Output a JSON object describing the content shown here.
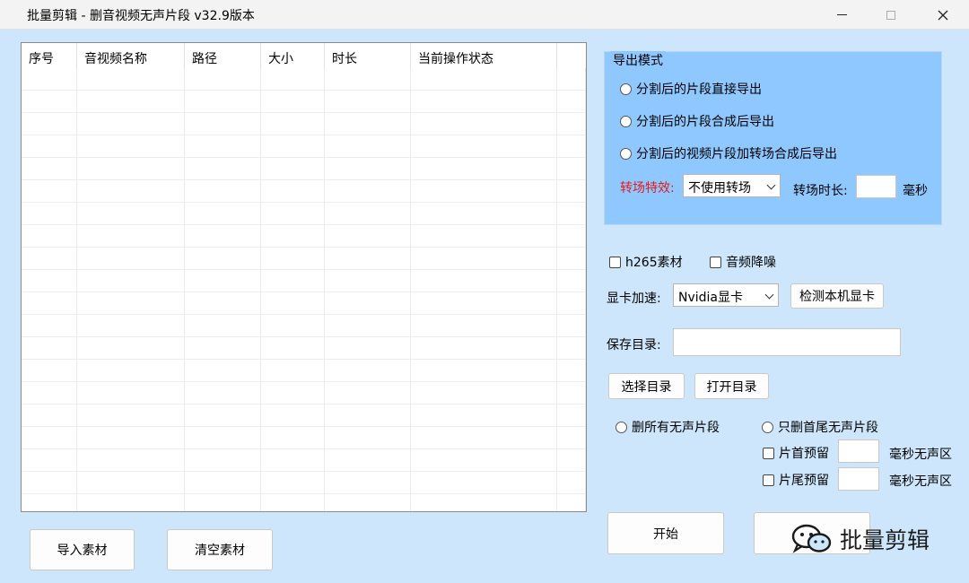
{
  "window": {
    "title": "批量剪辑 -  删音视频无声片段  v32.9版本"
  },
  "table": {
    "columns": [
      "序号",
      "音视频名称",
      "路径",
      "大小",
      "时长",
      "当前操作状态"
    ],
    "rows": []
  },
  "export_group": {
    "title": "导出模式",
    "options": [
      "分割后的片段直接导出",
      "分割后的片段合成后导出",
      "分割后的视频片段加转场合成后导出"
    ],
    "transition_effect_label": "转场特效:",
    "transition_effect_value": "不使用转场",
    "transition_duration_label": "转场时长:",
    "transition_duration_value": "",
    "transition_duration_unit": "毫秒"
  },
  "options": {
    "h265_label": "h265素材",
    "denoise_label": "音频降噪",
    "gpu_label": "显卡加速:",
    "gpu_value": "Nvidia显卡",
    "detect_gpu_button": "检测本机显卡",
    "save_dir_label": "保存目录:",
    "save_dir_value": "",
    "choose_dir_button": "选择目录",
    "open_dir_button": "打开目录",
    "delete_all_label": "删所有无声片段",
    "delete_head_tail_label": "只删首尾无声片段",
    "head_keep_label": "片首预留",
    "head_keep_value": "",
    "head_keep_unit": "毫秒无声区",
    "tail_keep_label": "片尾预留",
    "tail_keep_value": "",
    "tail_keep_unit": "毫秒无声区"
  },
  "actions": {
    "import_button": "导入素材",
    "clear_button": "清空素材",
    "start_button": "开始",
    "second_button": ""
  },
  "watermark": {
    "text": "批量剪辑",
    "icon": "wechat-icon"
  }
}
